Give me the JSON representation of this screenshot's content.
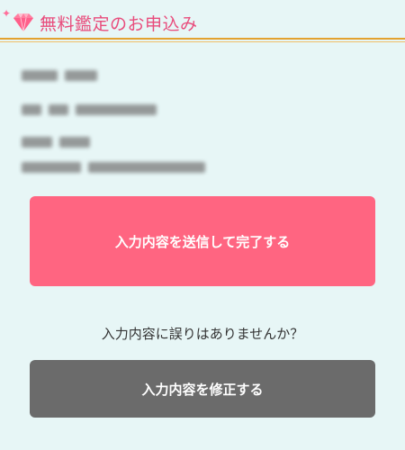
{
  "header": {
    "title": "無料鑑定のお申込み",
    "icon": "diamond-icon",
    "accent_color": "#e84c7c",
    "rule_color": "#e3a230"
  },
  "form_summary": {
    "rows": [
      "",
      "",
      "",
      ""
    ]
  },
  "actions": {
    "submit_label": "入力内容を送信して完了する",
    "confirm_question": "入力内容に誤りはありませんか？",
    "edit_label": "入力内容を修正する"
  },
  "colors": {
    "background": "#e7f6f6",
    "submit_button": "#ff6581",
    "edit_button": "#6b6b6b"
  }
}
